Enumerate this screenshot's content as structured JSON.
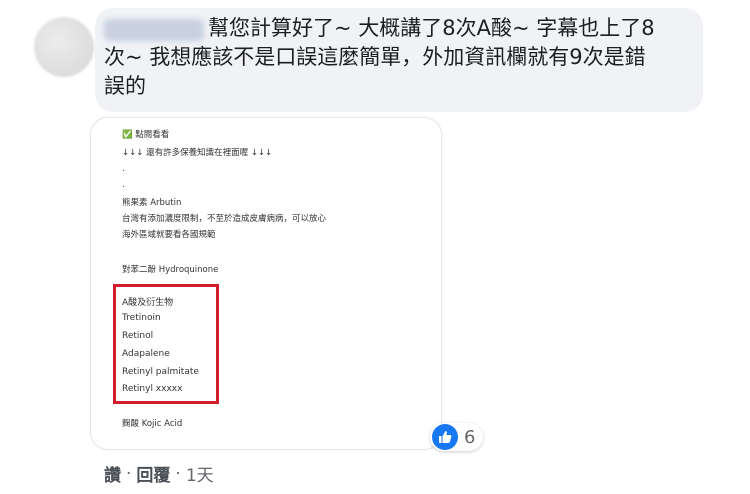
{
  "comment": {
    "text_line1": "幫您計算好了~ 大概講了8次A酸~ 字幕也上了8",
    "text_line2": "次~ 我想應該不是口誤這麼簡單，外加資訊欄就有9次是錯",
    "text_line3": "誤的"
  },
  "attachment": {
    "lines": [
      "✅ 點閱看看",
      "↓↓↓ 還有許多保養知識在裡面喔 ↓↓↓",
      ".",
      ".",
      "熊果素 Arbutin",
      "台灣有添加濃度限制，不至於造成皮膚病病，可以放心",
      "海外區域就要看各國規範",
      "對苯二酚 Hydroquinone"
    ],
    "highlight": [
      "A酸及衍生物",
      "Tretinoin",
      "Retinol",
      "Adapalene",
      "Retinyl palmitate",
      "Retinyl xxxxx"
    ],
    "last_line": "麴酸 Kojic Acid"
  },
  "reaction": {
    "icon": "thumbs-up-icon",
    "count": "6",
    "color": "#1877f2"
  },
  "actions": {
    "like": "讚",
    "reply": "回覆",
    "time": "1天",
    "separator": "·"
  }
}
